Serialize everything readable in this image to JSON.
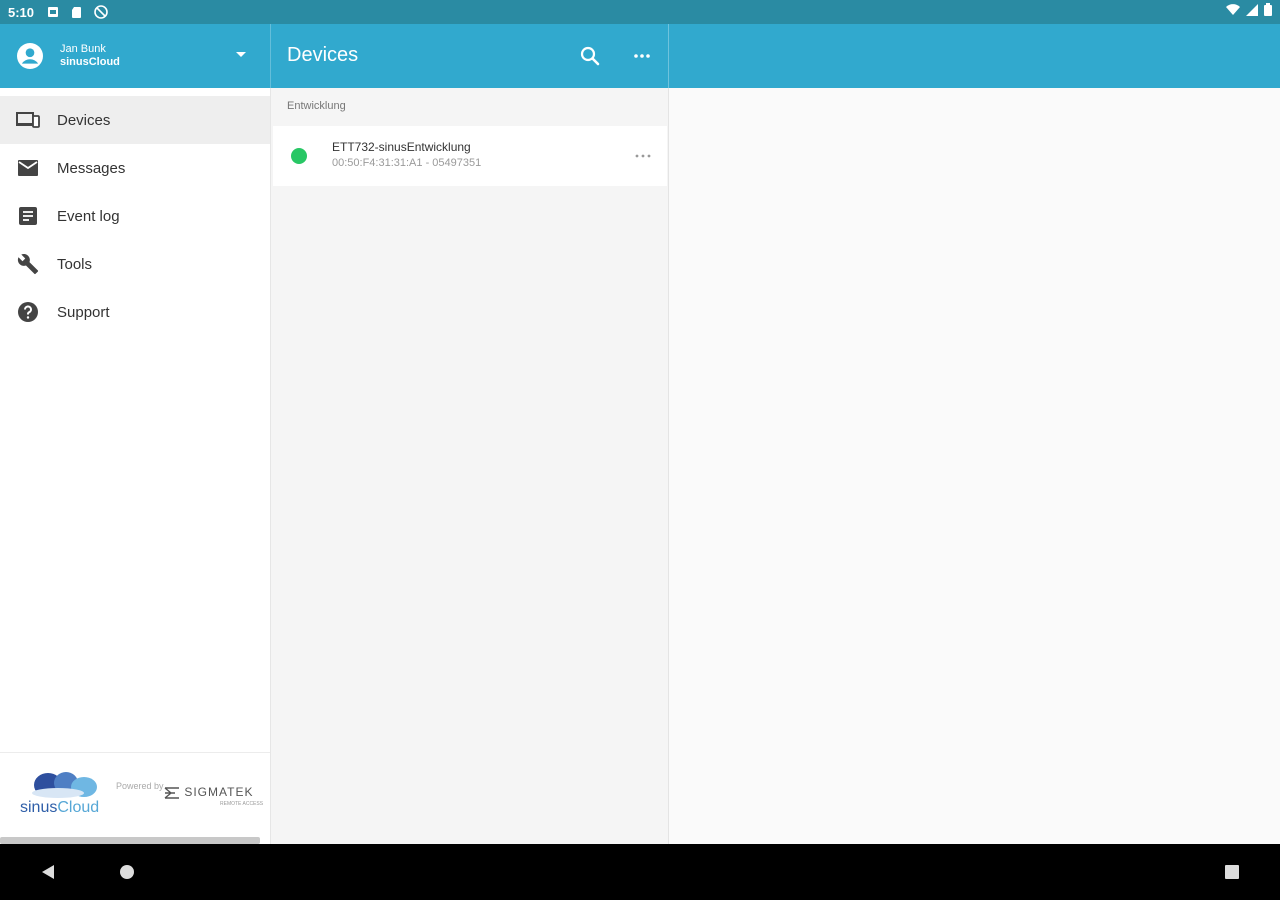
{
  "status_bar": {
    "time": "5:10",
    "icons": [
      "notification-icon",
      "sd-card-icon",
      "sync-off-icon",
      "wifi-icon",
      "signal-icon",
      "battery-icon"
    ]
  },
  "account": {
    "user_name": "Jan Bunk",
    "organization": "sinusCloud"
  },
  "header": {
    "title": "Devices"
  },
  "sidebar": {
    "items": [
      {
        "label": "Devices",
        "icon": "devices-icon",
        "active": true
      },
      {
        "label": "Messages",
        "icon": "mail-icon",
        "active": false
      },
      {
        "label": "Event log",
        "icon": "event-log-icon",
        "active": false
      },
      {
        "label": "Tools",
        "icon": "wrench-icon",
        "active": false
      },
      {
        "label": "Support",
        "icon": "help-icon",
        "active": false
      }
    ]
  },
  "brand": {
    "logo_text_a": "sinus",
    "logo_text_b": "Cloud",
    "powered_by": "Powered by",
    "partner": "SIGMATEK",
    "partner_sub": "REMOTE ACCESS"
  },
  "device_list": {
    "group": "Entwicklung",
    "devices": [
      {
        "name": "ETT732-sinusEntwicklung",
        "info": "00:50:F4:31:31:A1 - 05497351",
        "status": "online",
        "status_color": "#28c765"
      }
    ]
  },
  "colors": {
    "header": "#31a9ce",
    "status_bar": "#2a8ba3",
    "online": "#28c765"
  }
}
